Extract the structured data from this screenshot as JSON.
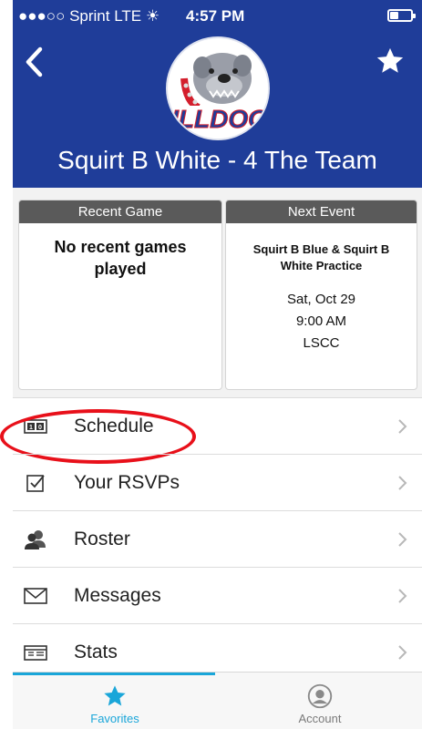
{
  "status_bar": {
    "carrier": "●●●○○ Sprint  LTE ☀",
    "time": "4:57 PM"
  },
  "header": {
    "team_name": "Squirt B White - 4 The Team",
    "logo_text": "ILLDOG",
    "bg_color": "#1f3d99"
  },
  "recent_game": {
    "heading": "Recent Game",
    "text": "No recent games played"
  },
  "next_event": {
    "heading": "Next Event",
    "name": "Squirt B Blue & Squirt B White Practice",
    "date": "Sat, Oct 29",
    "time": "9:00 AM",
    "location": "LSCC"
  },
  "menu": {
    "items": [
      {
        "label": "Schedule",
        "icon": "scoreboard-icon"
      },
      {
        "label": "Your RSVPs",
        "icon": "checkbox-icon"
      },
      {
        "label": "Roster",
        "icon": "people-icon"
      },
      {
        "label": "Messages",
        "icon": "envelope-icon"
      },
      {
        "label": "Stats",
        "icon": "stats-table-icon"
      }
    ]
  },
  "tabs": {
    "favorites": "Favorites",
    "account": "Account",
    "accent_color": "#1aa6d9"
  }
}
